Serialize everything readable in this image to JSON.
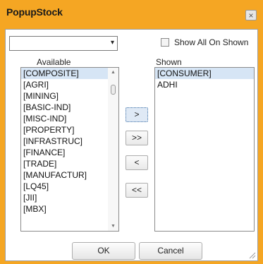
{
  "window": {
    "title": "PopupStock",
    "close_glyph": "×"
  },
  "filter": {
    "value": "",
    "arrow_glyph": "▾"
  },
  "show_all": {
    "label": "Show All On Shown",
    "checked": false
  },
  "available": {
    "label": "Available",
    "items": [
      "[COMPOSITE]",
      "[AGRI]",
      "[MINING]",
      "[BASIC-IND]",
      "[MISC-IND]",
      "[PROPERTY]",
      "[INFRASTRUC]",
      "[FINANCE]",
      "[TRADE]",
      "[MANUFACTUR]",
      "[LQ45]",
      "[JII]",
      "[MBX]"
    ],
    "scroll_up_glyph": "▲",
    "scroll_down_glyph": "▼"
  },
  "shown": {
    "label": "Shown",
    "items": [
      "[CONSUMER]",
      "ADHI"
    ]
  },
  "move_buttons": {
    "add": ">",
    "add_all": ">>",
    "remove": "<",
    "remove_all": "<<"
  },
  "dialog_buttons": {
    "ok": "OK",
    "cancel": "Cancel"
  },
  "colors": {
    "title_bar": "#f5a623",
    "selection": "#d6e5f5"
  }
}
